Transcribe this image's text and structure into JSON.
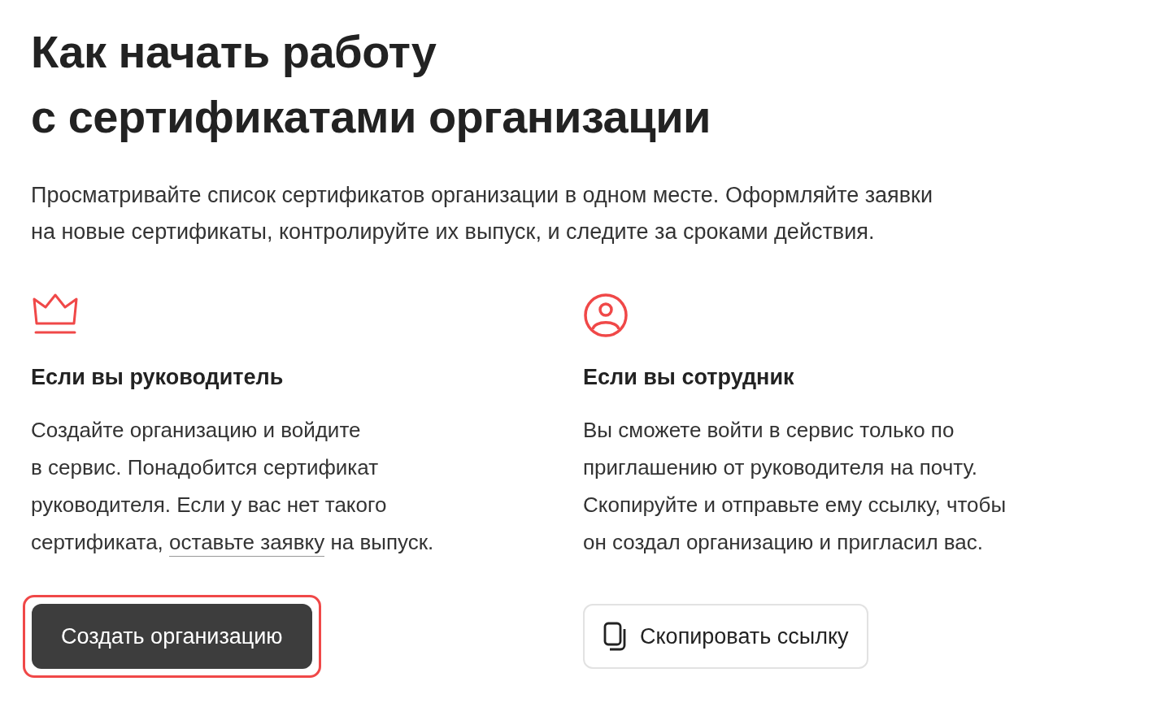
{
  "title": "Как начать работу\nс сертификатами организации",
  "intro": "Просматривайте список сертификатов организации в одном месте. Оформляйте заявки\nна новые сертификаты, контролируйте их выпуск, и следите за сроками действия.",
  "columns": [
    {
      "heading": "Если вы руководитель",
      "text": "Создайте организацию и войдите\nв сервис. Понадобится сертификат\nруководителя. Если у вас нет такого\nсертификата, ",
      "link": "оставьте заявку",
      "text_after": " на выпуск.",
      "button": {
        "label": "Создать организацию",
        "kind": "primary",
        "focused": true
      }
    },
    {
      "heading": "Если вы сотрудник",
      "text": "Вы сможете войти в сервис только по\nприглашению от руководителя на почту.\nСкопируйте и отправьте ему ссылку, чтобы\nон создал организацию и пригласил вас.",
      "button": {
        "label": "Скопировать ссылку",
        "kind": "secondary",
        "focused": false
      }
    }
  ]
}
